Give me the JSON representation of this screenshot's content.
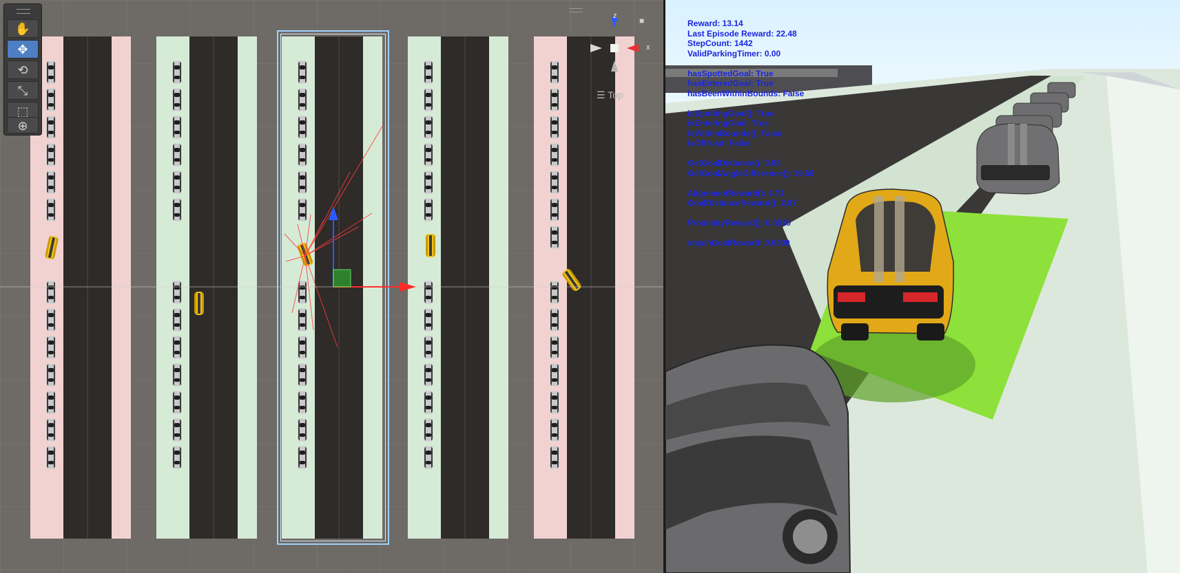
{
  "scene": {
    "gizmo": {
      "z_label": "z",
      "x_label": "x"
    },
    "projection_label": "Top",
    "tools": [
      {
        "name": "hand-tool",
        "glyph": "✋"
      },
      {
        "name": "move-tool",
        "glyph": "✥"
      },
      {
        "name": "rotate-tool",
        "glyph": "⟲"
      },
      {
        "name": "scale-tool",
        "glyph": "⤡"
      },
      {
        "name": "rect-tool",
        "glyph": "⬚"
      },
      {
        "name": "transform-tool",
        "glyph": "⊕"
      }
    ],
    "active_tool": "move-tool"
  },
  "hud": {
    "reward": "Reward: 13.14",
    "last_episode_reward": "Last Episode Reward: 22.48",
    "step_count": "StepCount: 1442",
    "valid_parking_timer": "ValidParkingTimer: 0.00",
    "has_spotted_goal": "hasSpottedGoal: True",
    "has_entered_goal": "hasEnteredGoal: True",
    "has_been_within_bounds": "hasBeenWithinBounds: False",
    "is_spotting_goal": "isSpottingGoal(): True",
    "is_entering_goal": "isEnteringGoal: True",
    "is_within_bounds": "isWithinBounds(): False",
    "is_offroad": "isOffroad: False",
    "goal_distance": "GetGoalDistance(): 0.85",
    "goal_angle_difference": "GetGoalAngleDifference(): 19.56",
    "alignment_reward": "AlignmentReward(): 4.71",
    "goal_distance_reward": "GoalDistanceReward(): 2.87",
    "proximity_reward": "ProximityReward(): 0.0010",
    "stay_in_goal_reward": "stayInGoalReward: 0.0000"
  },
  "colors": {
    "hud_text": "#1a25e0",
    "goal_zone": "#8ee03a",
    "agent_car": "#f0b81a",
    "pink_curb": "#f2d2d1",
    "green_curb": "#d6ebd6"
  }
}
